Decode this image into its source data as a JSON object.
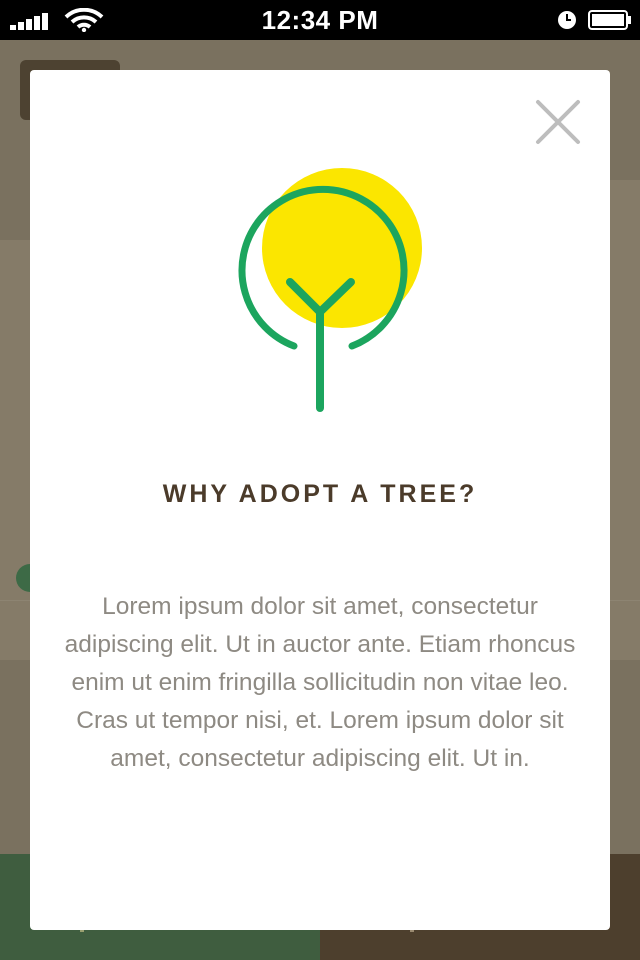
{
  "status_bar": {
    "time": "12:34 PM"
  },
  "modal": {
    "title": "WHY ADOPT A TREE?",
    "body": "Lorem ipsum dolor sit amet, consectetur adipiscing elit. Ut in auctor ante. Etiam rhoncus enim ut enim fringilla sollicitudin non vitae leo. Cras ut tempor nisi, et. Lorem ipsum dolor sit amet, consectetur adipiscing elit. Ut in.",
    "close_icon": "close-icon",
    "illustration_icon": "tree-icon"
  },
  "colors": {
    "title": "#4b3b2a",
    "body_text": "#8e8a83",
    "tree_green": "#1ca55e",
    "sun_yellow": "#fbe600",
    "close_gray": "#bdbdbd",
    "overlay": "#6e6656"
  }
}
